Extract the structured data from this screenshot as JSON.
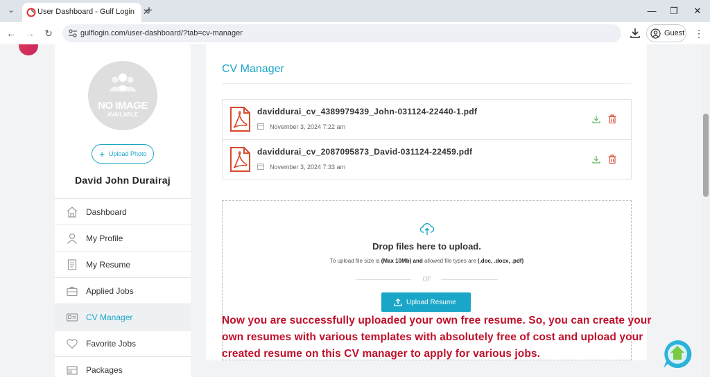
{
  "browser": {
    "tab_title": "User Dashboard - Gulf Login",
    "url": "gulflogin.com/user-dashboard/?tab=cv-manager",
    "profile_label": "Guest",
    "new_tab": "+",
    "close_tab": "✕"
  },
  "window": {
    "minimize": "—",
    "restore": "❐",
    "close": "✕"
  },
  "sidebar": {
    "avatar_text_1": "NO IMAGE",
    "avatar_text_2": "AVAILABLE",
    "upload_photo_label": "Upload Photo",
    "user_name": "David John Durairaj",
    "items": [
      {
        "label": "Dashboard",
        "icon": "dashboard-icon"
      },
      {
        "label": "My Profile",
        "icon": "profile-icon"
      },
      {
        "label": "My Resume",
        "icon": "resume-icon"
      },
      {
        "label": "Applied Jobs",
        "icon": "briefcase-icon"
      },
      {
        "label": "CV Manager",
        "icon": "id-card-icon",
        "active": true
      },
      {
        "label": "Favorite Jobs",
        "icon": "heart-icon"
      },
      {
        "label": "Packages",
        "icon": "package-icon"
      }
    ]
  },
  "main": {
    "title": "CV Manager",
    "files": [
      {
        "name": "daviddurai_cv_4389979439_John-031124-22440-1.pdf",
        "date": "November 3, 2024 7:22 am"
      },
      {
        "name": "daviddurai_cv_2087095873_David-031124-22459.pdf",
        "date": "November 3, 2024 7:33 am"
      }
    ],
    "dropzone": {
      "title": "Drop files here to upload.",
      "sub_1": "To upload file size is ",
      "sub_2": "(Max 10Mb)",
      "sub_3": " and",
      "sub_4": " allowed file types are ",
      "sub_5": "(.doc, .docx, .pdf)",
      "or": "or",
      "button_label": "Upload Resume"
    }
  },
  "overlay_text": "Now you are successfully uploaded your own free resume. So, you can create your own resumes with various templates with absolutely free of cost and upload your created resume on this CV manager to apply for various jobs.",
  "colors": {
    "accent": "#1aa6c8",
    "overlay_red": "#c0102a",
    "pdf_red": "#d9482b"
  }
}
